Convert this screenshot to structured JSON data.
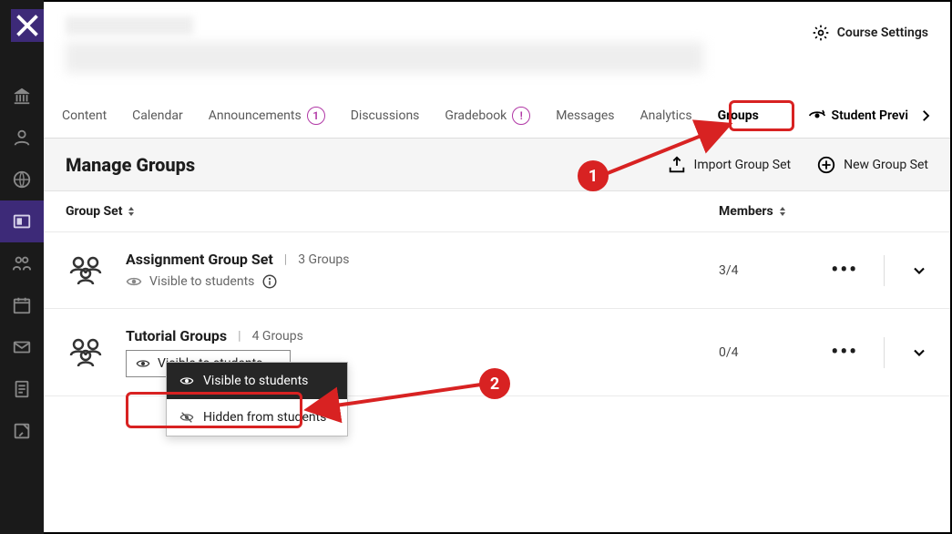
{
  "leftrail": {
    "items": [
      "institution",
      "profile",
      "activity",
      "courses",
      "groups",
      "calendar",
      "messages",
      "grades",
      "tools"
    ]
  },
  "header": {
    "settings_label": "Course Settings"
  },
  "tabs": {
    "content": "Content",
    "calendar": "Calendar",
    "announcements": "Announcements",
    "announcements_badge": "1",
    "discussions": "Discussions",
    "gradebook": "Gradebook",
    "gradebook_badge": "!",
    "messages": "Messages",
    "analytics": "Analytics",
    "groups": "Groups",
    "student_preview": "Student Previ"
  },
  "manage": {
    "title": "Manage Groups",
    "import_label": "Import Group Set",
    "new_label": "New Group Set"
  },
  "table": {
    "col_groupset": "Group Set",
    "col_members": "Members"
  },
  "rows": [
    {
      "name": "Assignment Group Set",
      "count_label": "3 Groups",
      "visibility_label": "Visible to students",
      "members": "3/4"
    },
    {
      "name": "Tutorial Groups",
      "count_label": "4 Groups",
      "visibility_label": "Visible to students",
      "members": "0/4"
    }
  ],
  "dropdown": {
    "visible": "Visible to students",
    "hidden": "Hidden from students"
  },
  "annotations": {
    "callout1": "1",
    "callout2": "2"
  }
}
